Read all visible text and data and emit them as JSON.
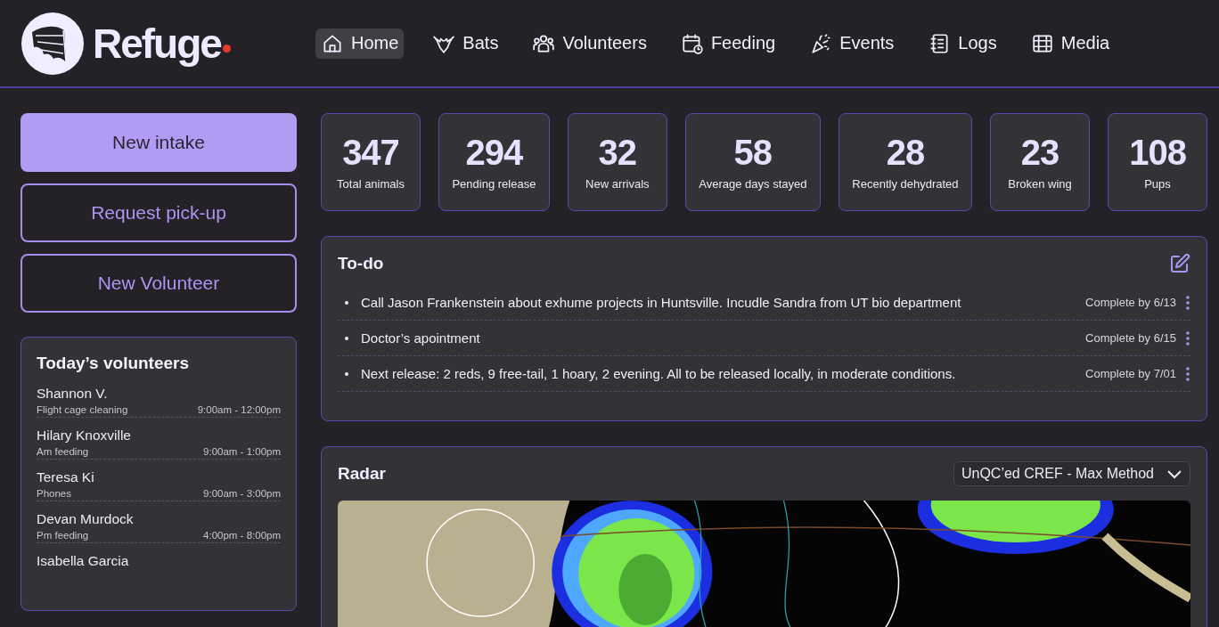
{
  "brand": {
    "name": "Refuge"
  },
  "nav": [
    {
      "label": "Home",
      "selected": true
    },
    {
      "label": "Bats",
      "selected": false
    },
    {
      "label": "Volunteers",
      "selected": false
    },
    {
      "label": "Feeding",
      "selected": false
    },
    {
      "label": "Events",
      "selected": false
    },
    {
      "label": "Logs",
      "selected": false
    },
    {
      "label": "Media",
      "selected": false
    }
  ],
  "actions": [
    {
      "label": "New intake",
      "kind": "primary"
    },
    {
      "label": "Request pick-up",
      "kind": "outline"
    },
    {
      "label": "New Volunteer",
      "kind": "outline"
    }
  ],
  "volunteers": {
    "title": "Today’s volunteers",
    "items": [
      {
        "name": "Shannon V.",
        "role": "Flight cage cleaning",
        "hours": "9:00am - 12:00pm"
      },
      {
        "name": "Hilary Knoxville",
        "role": "Am feeding",
        "hours": "9:00am - 1:00pm"
      },
      {
        "name": "Teresa Ki",
        "role": "Phones",
        "hours": "9:00am - 3:00pm"
      },
      {
        "name": "Devan Murdock",
        "role": "Pm feeding",
        "hours": "4:00pm - 8:00pm"
      },
      {
        "name": "Isabella Garcia"
      }
    ]
  },
  "stats": [
    {
      "value": "347",
      "label": "Total animals"
    },
    {
      "value": "294",
      "label": "Pending release"
    },
    {
      "value": "32",
      "label": "New arrivals"
    },
    {
      "value": "58",
      "label": "Average days stayed"
    },
    {
      "value": "28",
      "label": "Recently dehydrated"
    },
    {
      "value": "23",
      "label": "Broken wing"
    },
    {
      "value": "108",
      "label": "Pups"
    }
  ],
  "todo": {
    "title": "To-do",
    "items": [
      {
        "text": "Call Jason Frankenstein about exhume projects in Huntsville. Incudle Sandra from UT bio department",
        "due": "Complete by 6/13"
      },
      {
        "text": "Doctor’s apointment",
        "due": "Complete by 6/15"
      },
      {
        "text": "Next release: 2 reds, 9 free-tail, 1 hoary, 2 evening. All to be released locally, in moderate conditions.",
        "due": "Complete by 7/01"
      }
    ]
  },
  "radar": {
    "title": "Radar",
    "product": "UnQC’ed CREF - Max Method"
  }
}
